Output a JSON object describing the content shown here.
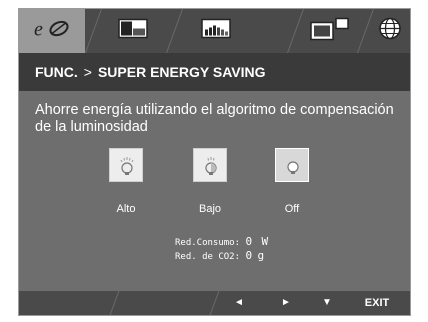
{
  "tabs": [
    {
      "name": "super-energy-saving-tab",
      "icon": "eco-icon",
      "active": true
    },
    {
      "name": "picture-tab",
      "icon": "picture-icon"
    },
    {
      "name": "color-tab",
      "icon": "color-bars-icon"
    },
    {
      "name": "display-tab",
      "icon": "display-icon"
    },
    {
      "name": "language-tab",
      "icon": "globe-icon"
    }
  ],
  "title": {
    "section": "FUNC.",
    "separator": ">",
    "current": "SUPER ENERGY SAVING"
  },
  "description": "Ahorre energía utilizando el algoritmo de compensación de la luminosidad",
  "options": [
    {
      "label": "Alto",
      "icon": "bulb-high-icon"
    },
    {
      "label": "Bajo",
      "icon": "bulb-low-icon"
    },
    {
      "label": "Off",
      "icon": "bulb-off-icon",
      "selected": true
    }
  ],
  "stats": {
    "consumption_label": "Red.Consumo:",
    "consumption_value": "0",
    "consumption_unit": "W",
    "co2_label": "Red. de CO2:",
    "co2_value": "0",
    "co2_unit": "g"
  },
  "footer": {
    "left": "◄",
    "right": "►",
    "down": "▼",
    "exit": "EXIT"
  },
  "colors": {
    "panel": "#6e6e6e",
    "tabbar": "#4a4a4a",
    "titlebar": "#3a3a3a"
  }
}
